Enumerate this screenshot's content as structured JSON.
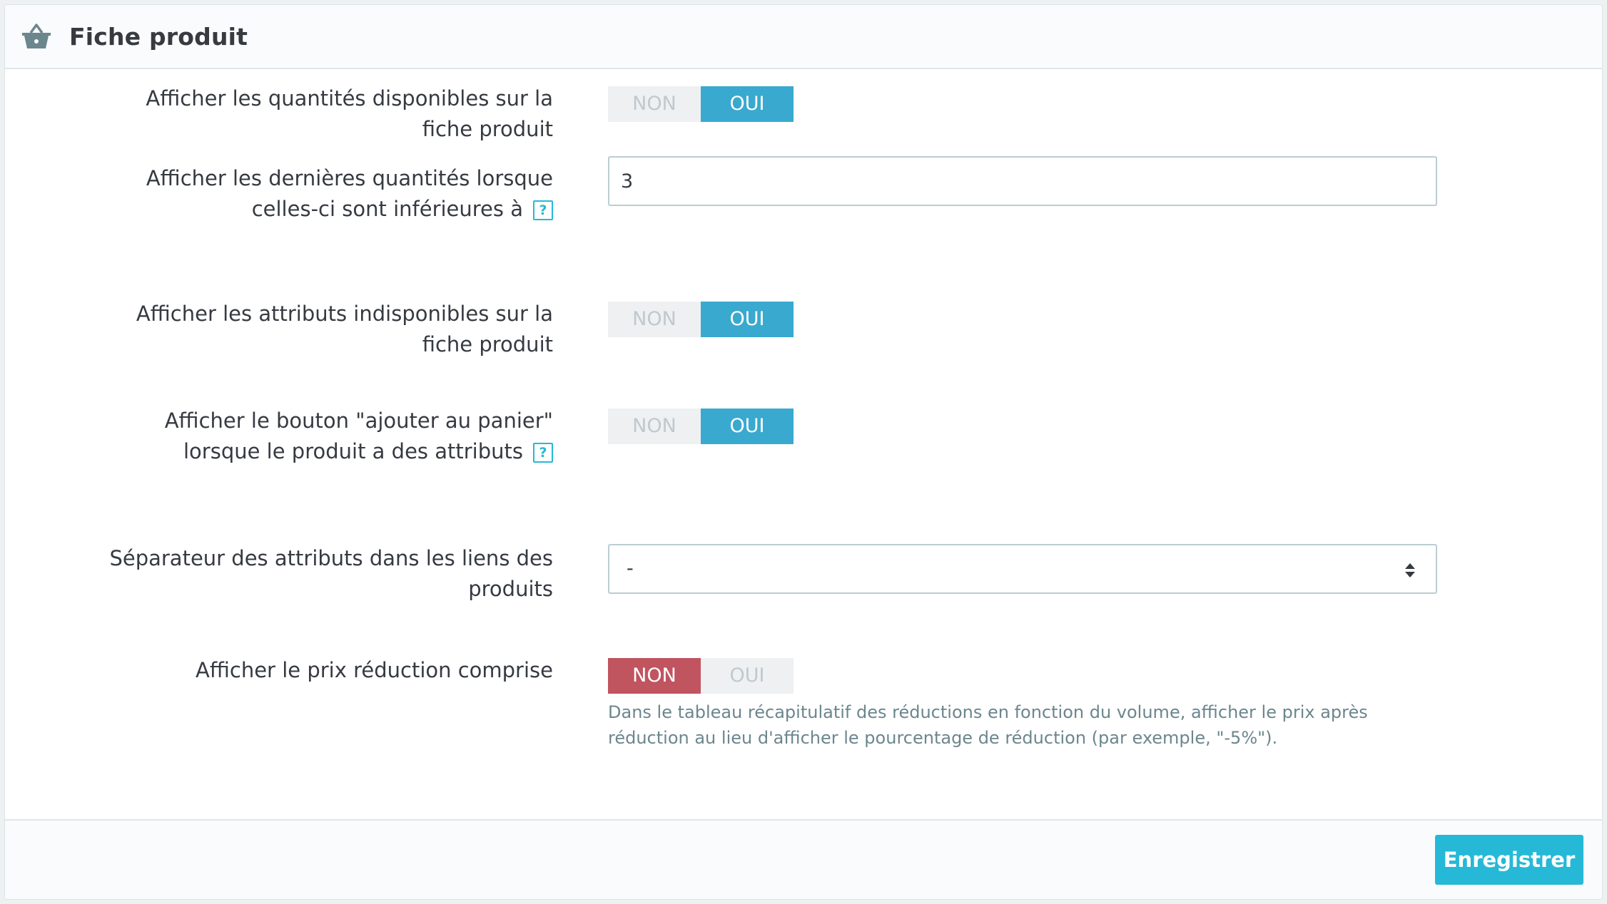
{
  "panel": {
    "title": "Fiche produit",
    "icon": "basket-icon"
  },
  "fields": {
    "show_quantities": {
      "label": "Afficher les quantités disponibles sur la fiche produit",
      "no_label": "NON",
      "yes_label": "OUI",
      "value": "OUI"
    },
    "last_quantities": {
      "label": "Afficher les dernières quantités lorsque celles-ci sont inférieures à",
      "help": "?",
      "value": "3"
    },
    "show_unavailable_attributes": {
      "label": "Afficher les attributs indisponibles sur la fiche produit",
      "no_label": "NON",
      "yes_label": "OUI",
      "value": "OUI"
    },
    "show_add_to_cart": {
      "label": "Afficher le bouton \"ajouter au panier\" lorsque le produit a des attributs",
      "help": "?",
      "no_label": "NON",
      "yes_label": "OUI",
      "value": "OUI"
    },
    "attribute_separator": {
      "label": "Séparateur des attributs dans les liens des produits",
      "selected": "-"
    },
    "show_discounted_price": {
      "label": "Afficher le prix réduction comprise",
      "no_label": "NON",
      "yes_label": "OUI",
      "value": "NON",
      "hint": "Dans le tableau récapitulatif des réductions en fonction du volume, afficher le prix après réduction au lieu d'afficher le pourcentage de réduction (par exemple, \"-5%\")."
    }
  },
  "footer": {
    "save_label": "Enregistrer"
  },
  "colors": {
    "accent": "#25b9d7",
    "toggle_yes": "#39a9cf",
    "toggle_no": "#c0545f"
  }
}
